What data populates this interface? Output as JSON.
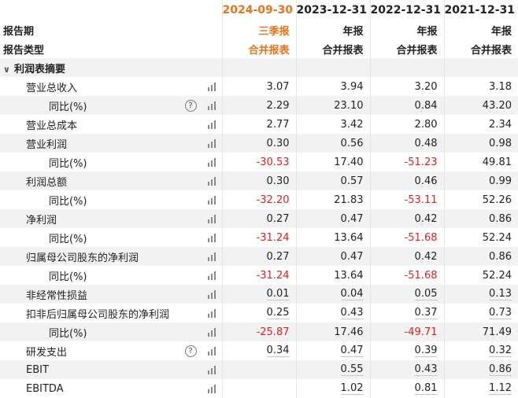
{
  "header": {
    "dates": [
      "2024-09-30",
      "2023-12-31",
      "2022-12-31",
      "2021-12-31"
    ],
    "period_label": "报告期",
    "period_values": [
      "三季报",
      "年报",
      "年报",
      "年报"
    ],
    "type_label": "报告类型",
    "type_values": [
      "合并报表",
      "合并报表",
      "合并报表",
      "合并报表"
    ],
    "highlight_color": "#e8731a"
  },
  "section": {
    "title": "利润表摘要",
    "icon": "chevron-down-icon"
  },
  "rows": [
    {
      "label": "营业总收入",
      "level": 1,
      "help": false,
      "values": [
        "3.07",
        "3.94",
        "3.20",
        "3.18"
      ],
      "negative": [
        false,
        false,
        false,
        false
      ]
    },
    {
      "label": "同比(%)",
      "level": 2,
      "help": true,
      "values": [
        "2.29",
        "23.10",
        "0.84",
        "43.20"
      ],
      "negative": [
        false,
        false,
        false,
        false
      ]
    },
    {
      "label": "营业总成本",
      "level": 1,
      "help": false,
      "values": [
        "2.77",
        "3.42",
        "2.80",
        "2.34"
      ],
      "negative": [
        false,
        false,
        false,
        false
      ]
    },
    {
      "label": "营业利润",
      "level": 1,
      "help": false,
      "values": [
        "0.30",
        "0.56",
        "0.48",
        "0.98"
      ],
      "negative": [
        false,
        false,
        false,
        false
      ]
    },
    {
      "label": "同比(%)",
      "level": 2,
      "help": false,
      "values": [
        "-30.53",
        "17.40",
        "-51.23",
        "49.81"
      ],
      "negative": [
        true,
        false,
        true,
        false
      ]
    },
    {
      "label": "利润总额",
      "level": 1,
      "help": false,
      "values": [
        "0.30",
        "0.57",
        "0.46",
        "0.99"
      ],
      "negative": [
        false,
        false,
        false,
        false
      ]
    },
    {
      "label": "同比(%)",
      "level": 2,
      "help": false,
      "values": [
        "-32.20",
        "21.83",
        "-53.11",
        "52.26"
      ],
      "negative": [
        true,
        false,
        true,
        false
      ]
    },
    {
      "label": "净利润",
      "level": 1,
      "help": false,
      "values": [
        "0.27",
        "0.47",
        "0.42",
        "0.86"
      ],
      "negative": [
        false,
        false,
        false,
        false
      ]
    },
    {
      "label": "同比(%)",
      "level": 2,
      "help": false,
      "values": [
        "-31.24",
        "13.64",
        "-51.68",
        "52.24"
      ],
      "negative": [
        true,
        false,
        true,
        false
      ]
    },
    {
      "label": "归属母公司股东的净利润",
      "level": 1,
      "help": false,
      "values": [
        "0.27",
        "0.47",
        "0.42",
        "0.86"
      ],
      "negative": [
        false,
        false,
        false,
        false
      ]
    },
    {
      "label": "同比(%)",
      "level": 2,
      "help": false,
      "values": [
        "-31.24",
        "13.64",
        "-51.68",
        "52.24"
      ],
      "negative": [
        true,
        false,
        true,
        false
      ]
    },
    {
      "label": "非经常性损益",
      "level": 1,
      "help": false,
      "values": [
        "0.01",
        "0.04",
        "0.05",
        "0.13"
      ],
      "negative": [
        false,
        false,
        false,
        false
      ],
      "underline": true
    },
    {
      "label": "扣非后归属母公司股东的净利润",
      "level": 1,
      "help": false,
      "values": [
        "0.25",
        "0.43",
        "0.37",
        "0.73"
      ],
      "negative": [
        false,
        false,
        false,
        false
      ],
      "underline": true
    },
    {
      "label": "同比(%)",
      "level": 2,
      "help": false,
      "values": [
        "-25.87",
        "17.46",
        "-49.71",
        "71.49"
      ],
      "negative": [
        true,
        false,
        true,
        false
      ]
    },
    {
      "label": "研发支出",
      "level": 1,
      "help": true,
      "values": [
        "0.34",
        "0.47",
        "0.39",
        "0.32"
      ],
      "negative": [
        false,
        false,
        false,
        false
      ],
      "underline": true
    },
    {
      "label": "EBIT",
      "level": 1,
      "help": false,
      "values": [
        "",
        "0.55",
        "0.43",
        "0.86"
      ],
      "negative": [
        false,
        false,
        false,
        false
      ],
      "underline": true
    },
    {
      "label": "EBITDA",
      "level": 1,
      "help": false,
      "values": [
        "",
        "1.02",
        "0.81",
        "1.12"
      ],
      "negative": [
        false,
        false,
        false,
        false
      ],
      "underline": true
    }
  ],
  "colors": {
    "negative": "#e02020",
    "row_alt": "#f2f2f2"
  }
}
